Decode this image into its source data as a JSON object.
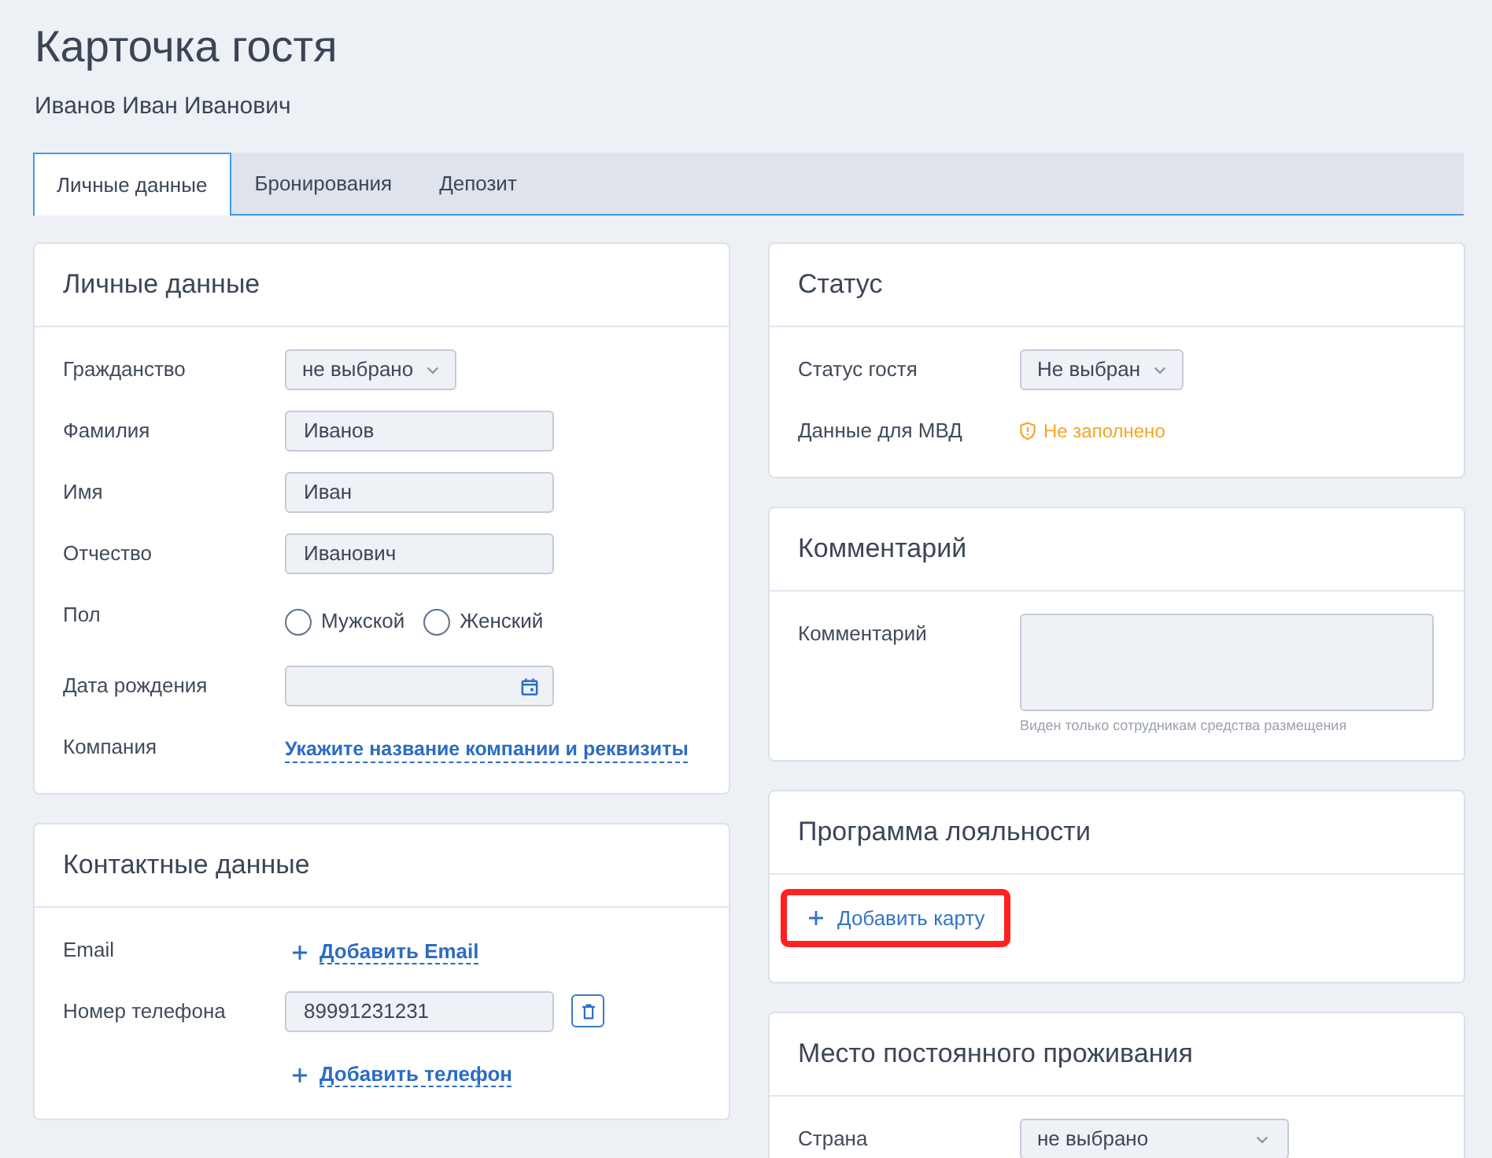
{
  "page": {
    "title": "Карточка гостя",
    "subtitle": "Иванов Иван Иванович"
  },
  "tabs": [
    {
      "label": "Личные данные",
      "selected": true
    },
    {
      "label": "Бронирования",
      "selected": false
    },
    {
      "label": "Депозит",
      "selected": false
    }
  ],
  "left_column": {
    "cards": [
      {
        "title": "Личные данные",
        "rows": [
          {
            "kind": "select",
            "label": "Гражданство",
            "value": "не выбрано"
          },
          {
            "kind": "input",
            "label": "Фамилия",
            "value": "Иванов"
          },
          {
            "kind": "input",
            "label": "Имя",
            "value": "Иван"
          },
          {
            "kind": "input",
            "label": "Отчество",
            "value": "Иванович"
          },
          {
            "kind": "radio",
            "label": "Пол",
            "options": [
              {
                "label": "Мужской",
                "selected": false
              },
              {
                "label": "Женский",
                "selected": false
              }
            ]
          },
          {
            "kind": "date",
            "label": "Дата рождения"
          },
          {
            "kind": "link",
            "label": "Компания",
            "link": "Укажите название компании и реквизиты"
          }
        ]
      },
      {
        "title": "Контактные данные",
        "rows": [
          {
            "kind": "add",
            "label": "Email",
            "action": "Добавить Email"
          },
          {
            "kind": "phone",
            "label": "Номер телефона",
            "value": "89991231231"
          },
          {
            "kind": "add",
            "action": "Добавить телефон"
          }
        ]
      }
    ]
  },
  "right_column": {
    "cards": [
      {
        "title": "Статус",
        "rows": [
          {
            "kind": "select",
            "label": "Статус гостя",
            "value": "Не выбран"
          },
          {
            "kind": "warning",
            "label": "Данные для МВД",
            "value": "Не заполнено"
          }
        ]
      },
      {
        "title": "Комментарий",
        "rows": [
          {
            "kind": "textarea",
            "label": "Комментарий",
            "hint": "Виден только сотрудникам средства размещения"
          }
        ]
      },
      {
        "title": "Программа лояльности",
        "rows": [
          {
            "kind": "add_card",
            "action": "Добавить карту",
            "highlighted": true
          }
        ]
      },
      {
        "title": "Место постоянного проживания",
        "rows": [
          {
            "kind": "select_wide",
            "label": "Страна",
            "value": "не выбрано"
          }
        ]
      }
    ]
  }
}
